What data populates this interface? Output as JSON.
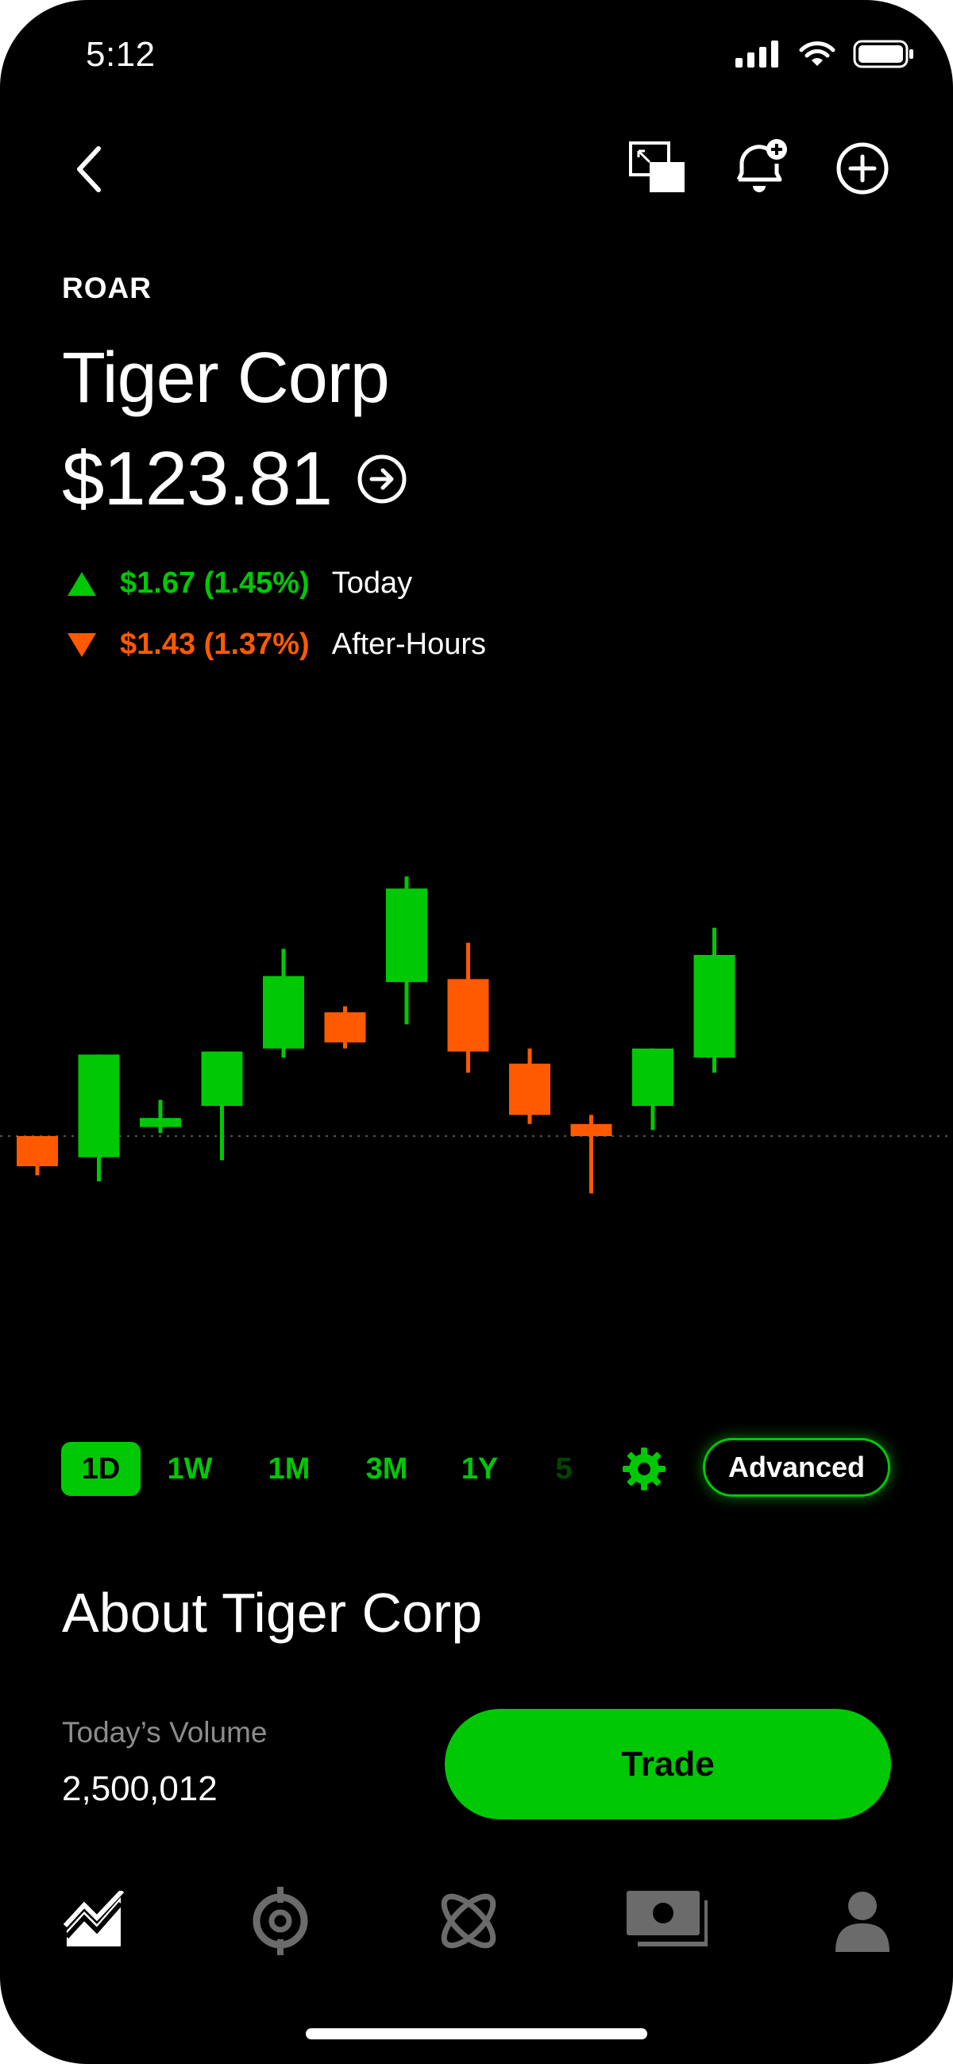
{
  "status_bar": {
    "time": "5:12"
  },
  "stock": {
    "ticker": "ROAR",
    "name": "Tiger Corp",
    "price": "$123.81",
    "today_change": "$1.67 (1.45%)",
    "today_label": "Today",
    "afterhours_change": "$1.43 (1.37%)",
    "afterhours_label": "After-Hours"
  },
  "colors": {
    "up": "#00c805",
    "down": "#ff5a00",
    "background": "#000000"
  },
  "chart_data": {
    "type": "candlestick",
    "reference_line": "dotted previous close",
    "candles": [
      {
        "open": 0.0,
        "close": -1.0,
        "high": 0.0,
        "low": -1.3
      },
      {
        "open": -0.7,
        "close": 2.7,
        "high": 2.7,
        "low": -1.5
      },
      {
        "open": 0.3,
        "close": 0.6,
        "high": 1.2,
        "low": 0.1
      },
      {
        "open": 1.0,
        "close": 2.8,
        "high": 2.8,
        "low": -0.8
      },
      {
        "open": 2.9,
        "close": 5.3,
        "high": 6.2,
        "low": 2.6
      },
      {
        "open": 4.1,
        "close": 3.1,
        "high": 4.3,
        "low": 2.9
      },
      {
        "open": 5.1,
        "close": 8.2,
        "high": 8.6,
        "low": 3.7
      },
      {
        "open": 5.2,
        "close": 2.8,
        "high": 6.4,
        "low": 2.1
      },
      {
        "open": 2.4,
        "close": 0.7,
        "high": 2.9,
        "low": 0.4
      },
      {
        "open": 0.4,
        "close": 0.0,
        "high": 0.7,
        "low": -1.9
      },
      {
        "open": 1.0,
        "close": 2.9,
        "high": 2.9,
        "low": 0.2
      },
      {
        "open": 2.6,
        "close": 6.0,
        "high": 6.9,
        "low": 2.1
      }
    ]
  },
  "ranges": {
    "items": [
      "1D",
      "1W",
      "1M",
      "3M",
      "1Y",
      "5"
    ],
    "active": "1D",
    "advanced_label": "Advanced"
  },
  "about": {
    "title": "About Tiger Corp",
    "volume_label": "Today’s Volume",
    "volume_value": "2,500,012"
  },
  "trade_label": "Trade"
}
